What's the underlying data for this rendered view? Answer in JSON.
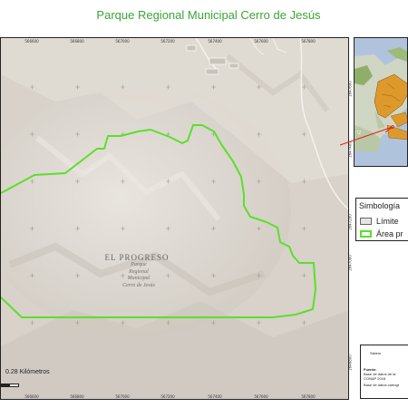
{
  "map_title": "Parque Regional Municipal Cerro de Jesús",
  "main_map": {
    "x_ticks_top": [
      "566600",
      "566800",
      "567000",
      "567200",
      "567400",
      "567600",
      "567800"
    ],
    "x_ticks_bottom": [
      "566600",
      "566800",
      "567000",
      "567200",
      "567400",
      "567600",
      "567800"
    ],
    "y_ticks_right": [
      "1647600",
      "1647400",
      "1647200",
      "1647000",
      "1646800"
    ],
    "place_name": "EL PROGRESO",
    "park_label_lines": [
      "Parque",
      "Regional",
      "Municipal",
      "Cerro de Jesús"
    ],
    "boundary_color": "#5ae02a",
    "scale_label": "0.28 Kilómetros"
  },
  "inset_map": {
    "visible_label": "TZ"
  },
  "legend": {
    "title": "Simbología",
    "items": [
      {
        "label": "Límite",
        "swatch_fill": "#e5e5e5",
        "swatch_border": "#666666"
      },
      {
        "label": "Área pr",
        "swatch_fill": "#ffffff",
        "swatch_border": "#5ae02a"
      }
    ]
  },
  "info_box": {
    "title": "Sistem",
    "source_heading": "Fuente:",
    "source_lines": [
      "Base de datos de la",
      "CONAP 2016",
      "Base de datos cartogr"
    ]
  }
}
